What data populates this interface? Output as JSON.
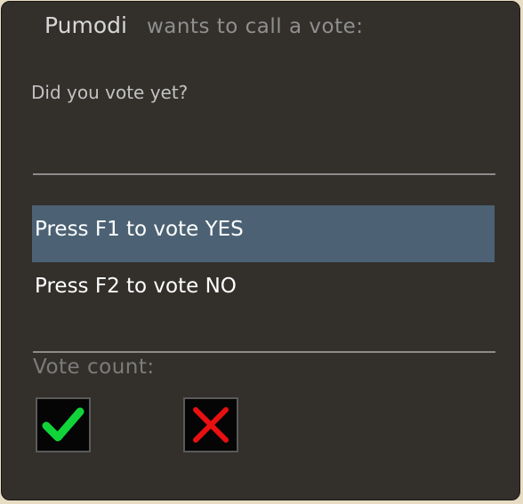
{
  "vote": {
    "caller": "Pumodi",
    "call_text": "wants to call a vote:",
    "question": "Did you vote yet?",
    "options": [
      {
        "label": "Press F1 to vote YES",
        "selected": true
      },
      {
        "label": "Press F2 to vote NO",
        "selected": false
      }
    ],
    "vote_count_label": "Vote count:",
    "icons": {
      "yes": "green-checkmark-icon",
      "no": "red-x-icon"
    },
    "colors": {
      "panel_bg": "#33302c",
      "selected_option_bg": "#4c6274",
      "yes_icon": "#11d43a",
      "no_icon": "#e81010"
    }
  }
}
